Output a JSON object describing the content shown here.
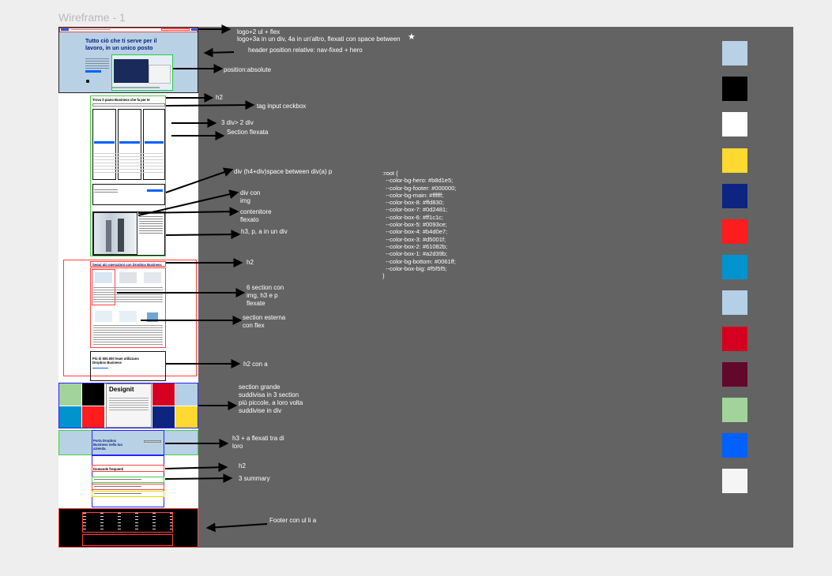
{
  "frame_title": "Wireframe - 1",
  "mockup": {
    "hero_title": "Tutto ciò che ti serve per il lavoro, in un unico posto",
    "plans_title": "Trova il piano Business che fa per te",
    "ops_title": "Segui più operazioni con Dropbox Business",
    "teams_title": "Più di 500.000 team utilizzano Dropbox Business",
    "banner_title": "Porta Dropbox Business nella tua azienda.",
    "faq_title": "Domande frequenti",
    "logo_text": "Designit"
  },
  "annotations": {
    "nav_line1": "logo+2 ul + flex",
    "nav_line2": "logo+3a in un div, 4a in un'altro, flexati con space between",
    "header_position": "header position relative: nav-fixed + hero",
    "position_absolute": "position:absolute",
    "h2_first": "h2",
    "tag_input": "tag input ceckbox",
    "three_div": "3 div> 2 div",
    "section_flex": "Section flexata",
    "div_h4": "div (h4+div)space between div(a) p",
    "div_img": "div con img",
    "container_flex": "contenitore flexato",
    "h3_p_a": "h3, p, a in un div",
    "h2_second": "h2",
    "six_sections": "6 section con img, h3 e p flexate",
    "external_section": "section esterna con flex",
    "h2_with_a": "h2 con a",
    "big_section": "section grande suddivisa in 3 section più piccole, a loro volta suddivise in div",
    "h3_a_flex": "h3 + a flexati tra di loro",
    "h2_third": "h2",
    "three_summary": "3 summary",
    "footer": "Footer con ul li a"
  },
  "css_root": [
    ":root {",
    "  --color-bg-hero: #b8d1e5;",
    "  --color-bg-footer: #000000;",
    "  --color-bg-main: #ffffff;",
    "  --color-box-8: #ffd830;",
    "  --color-box-7: #0d2481;",
    "  --color-box-6: #ff1c1c;",
    "  --color-box-5: #0093ce;",
    "  --color-box-4: #b4d0e7;",
    "  --color-box-3: #d5001f;",
    "  --color-box-2: #61082b;",
    "  --color-box-1: #a2d39b;",
    "  --color-bg-bottom: #0061ff;",
    "  --color-box-big: #f5f5f5;",
    "}"
  ],
  "swatches": [
    "#b8d1e5",
    "#000000",
    "#ffffff",
    "#ffd830",
    "#0d2481",
    "#ff1c1c",
    "#0093ce",
    "#b4d0e7",
    "#d5001f",
    "#61082b",
    "#a2d39b",
    "#0061ff",
    "#f5f5f5"
  ]
}
